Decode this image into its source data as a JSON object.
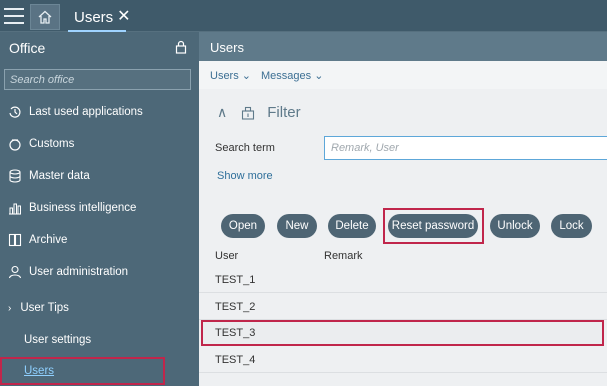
{
  "topbar": {
    "menu_icon": "hamburger-icon",
    "home_icon": "home-icon",
    "tab_label": "Users",
    "tab_close": "✕"
  },
  "sidebar": {
    "title": "Office",
    "lock_icon": "lock-icon",
    "search_placeholder": "Search office",
    "items": [
      {
        "label": "Last used applications",
        "icon": "history-icon"
      },
      {
        "label": "Customs",
        "icon": "customs-icon"
      },
      {
        "label": "Master data",
        "icon": "database-icon"
      },
      {
        "label": "Business intelligence",
        "icon": "chart-icon"
      },
      {
        "label": "Archive",
        "icon": "archive-icon"
      },
      {
        "label": "User administration",
        "icon": "user-icon"
      }
    ],
    "tips_label": "User Tips",
    "settings_label": "User settings",
    "users_label": "Users"
  },
  "main": {
    "title": "Users",
    "subnav": [
      "Users",
      "Messages"
    ],
    "filter_label": "Filter",
    "search_term_label": "Search term",
    "search_term_placeholder": "Remark, User",
    "show_more": "Show more",
    "buttons": [
      "Open",
      "New",
      "Delete",
      "Reset password",
      "Unlock",
      "Lock"
    ],
    "columns": [
      "User",
      "Remark"
    ],
    "rows": [
      "TEST_1",
      "TEST_2",
      "TEST_3",
      "TEST_4"
    ]
  },
  "colors": {
    "topbar": "#3f5a6a",
    "sidebar": "#4d6878",
    "highlight": "#c0264b",
    "link": "#3c6f93"
  }
}
